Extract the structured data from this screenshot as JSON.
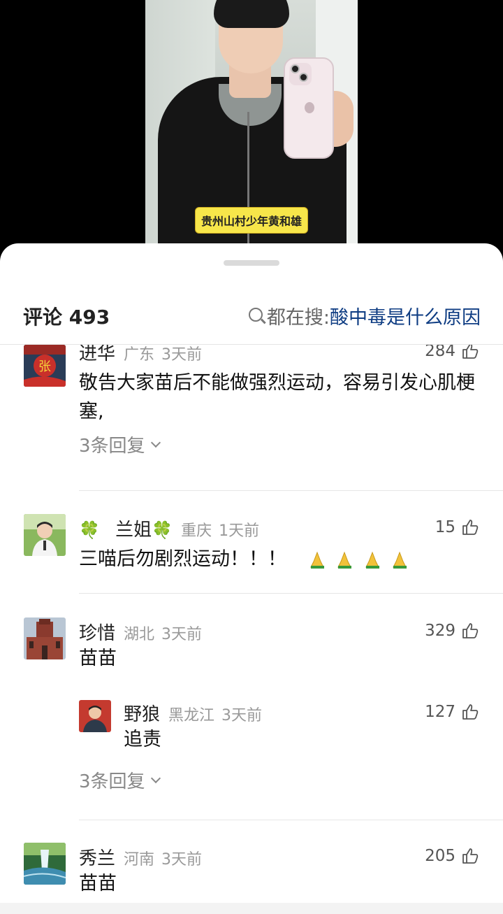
{
  "video": {
    "caption": "贵州山村少年黄和雄"
  },
  "header": {
    "comments_label": "评论 493",
    "search_prefix": "都在搜:",
    "search_term": "酸中毒是什么原因"
  },
  "comments": [
    {
      "user": "进华",
      "location": "广东",
      "time": "3天前",
      "likes": "284",
      "text": "敬告大家苗后不能做强烈运动，容易引发心肌梗塞,",
      "replies_label": "3条回复",
      "avatar_text": "张"
    },
    {
      "user": "兰姐",
      "user_prefix": "🍀",
      "user_suffix": "🍀",
      "location": "重庆",
      "time": "1天前",
      "likes": "15",
      "text": "三喵后勿剧烈运动！！！"
    },
    {
      "user": "珍惜",
      "location": "湖北",
      "time": "3天前",
      "likes": "329",
      "text": "苗苗",
      "reply": {
        "user": "野狼",
        "location": "黑龙江",
        "time": "3天前",
        "likes": "127",
        "text": "追责"
      },
      "replies_label": "3条回复"
    },
    {
      "user": "秀兰",
      "location": "河南",
      "time": "3天前",
      "likes": "205",
      "text": "苗苗"
    }
  ],
  "colors": {
    "search_term": "#0f3d83",
    "caption_bg": "#f7e64a",
    "meta_gray": "#999999"
  }
}
